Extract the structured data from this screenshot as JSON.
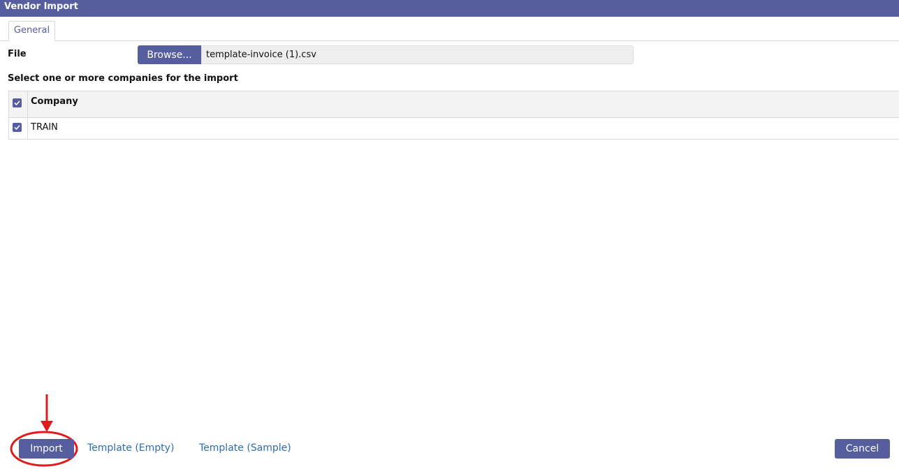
{
  "window": {
    "title": "Vendor Import"
  },
  "tabs": [
    {
      "label": "General"
    }
  ],
  "file": {
    "label": "File",
    "browse_label": "Browse...",
    "value": "template-invoice (1).csv"
  },
  "companies": {
    "caption": "Select one or more companies for the import",
    "header": "Company",
    "header_checked": true,
    "rows": [
      {
        "name": "TRAIN",
        "checked": true
      }
    ]
  },
  "footer": {
    "import_label": "Import",
    "template_empty_label": "Template (Empty)",
    "template_sample_label": "Template (Sample)",
    "cancel_label": "Cancel"
  },
  "colors": {
    "accent": "#575e9f",
    "link": "#2e6db4",
    "annotation": "#e01b1b"
  },
  "icons": {
    "checkbox_checked": "check-icon",
    "annotation_arrow": "arrow-down-icon",
    "annotation_circle": "highlight-circle"
  }
}
